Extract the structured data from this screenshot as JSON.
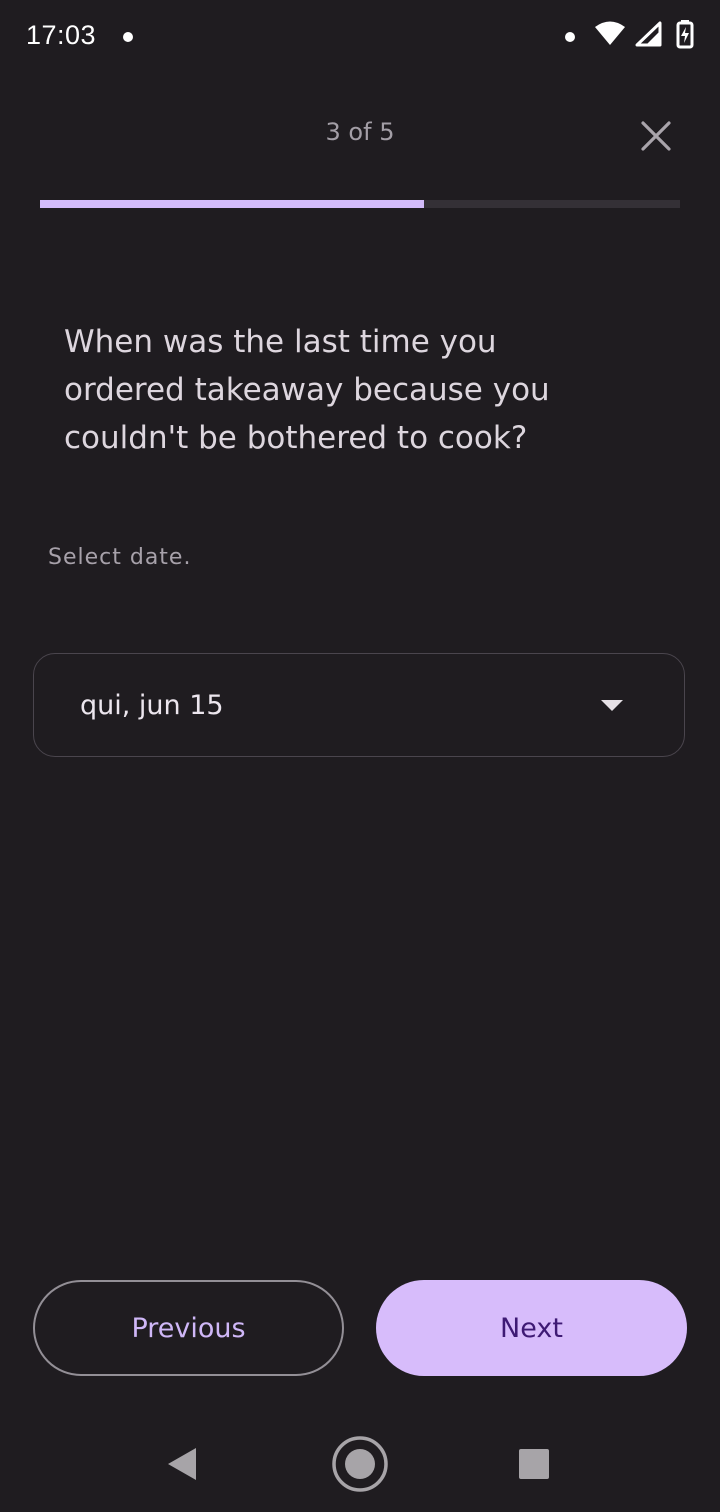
{
  "status_bar": {
    "time": "17:03",
    "icons": [
      "notification-dot-icon",
      "wifi-icon",
      "cell-signal-icon",
      "battery-charging-icon"
    ]
  },
  "header": {
    "step_label": "3 of 5",
    "close_icon": "close-icon"
  },
  "progress": {
    "current_step": 3,
    "total_steps": 5,
    "fraction": 0.6,
    "fill_color": "#d3bbfa",
    "track_color": "#343036"
  },
  "question": {
    "text": "When was the last time you ordered takeaway because you couldn't be bothered to cook?"
  },
  "hint": {
    "text": "Select date."
  },
  "date_field": {
    "value": "qui, jun 15",
    "icon": "dropdown-caret-icon"
  },
  "actions": {
    "previous_label": "Previous",
    "next_label": "Next",
    "accent_color": "#d7bcfb"
  },
  "nav_bar": {
    "icons": [
      "back-icon",
      "home-icon",
      "recents-icon"
    ]
  },
  "colors": {
    "background": "#1f1c20",
    "primary_text": "#ddd6de",
    "secondary_text": "#a39ea6"
  }
}
